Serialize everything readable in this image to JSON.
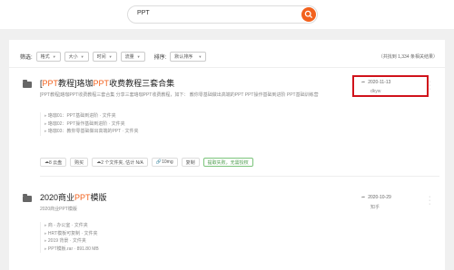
{
  "search": {
    "value": "PPT"
  },
  "filters": {
    "label": "筛选:",
    "format": "格式",
    "size": "大小",
    "time": "时间",
    "traffic": "流量",
    "sort_label": "排序:",
    "sort_value": "默认排序",
    "total": "（共找到 1,334 条相关结果）"
  },
  "results": [
    {
      "title_parts": [
        "[",
        "PPT",
        "教程]珞珈",
        "PPT",
        "收费教程三套合集"
      ],
      "desc": "[PPT教程]珞珈PPT收费教程三套合集 分享三套珞珈PPT收费教程，如下： 教你零基础做出高端的PPT PPT操作基础到进阶 PPT基础训练营",
      "files": [
        "珞珈01：PPT基础到进阶 · 文件夹",
        "珞珈02：PPT操作基础到进阶 · 文件夹",
        "珞珈03：教你零基础做出高端的PPT · 文件夹"
      ],
      "meta": [
        "8 云盘",
        "购买",
        "2 个文件夹, 估计 N/A",
        "10mg",
        "复制"
      ],
      "tag": "提取失败，无需授权",
      "date": "2020-11-13",
      "sub": "dkyw"
    },
    {
      "title_parts": [
        "2020商业",
        "PPT",
        "模版"
      ],
      "desc": "2020商业PPT模版",
      "files": [
        "商 - 办公室 · 文件夹",
        "HRT模板可复制 · 文件夹",
        "2019 背景 · 文件夹",
        "PPT模板.rar · 891.80 MB"
      ],
      "date": "2020-10-29",
      "sub": "知乎"
    }
  ]
}
